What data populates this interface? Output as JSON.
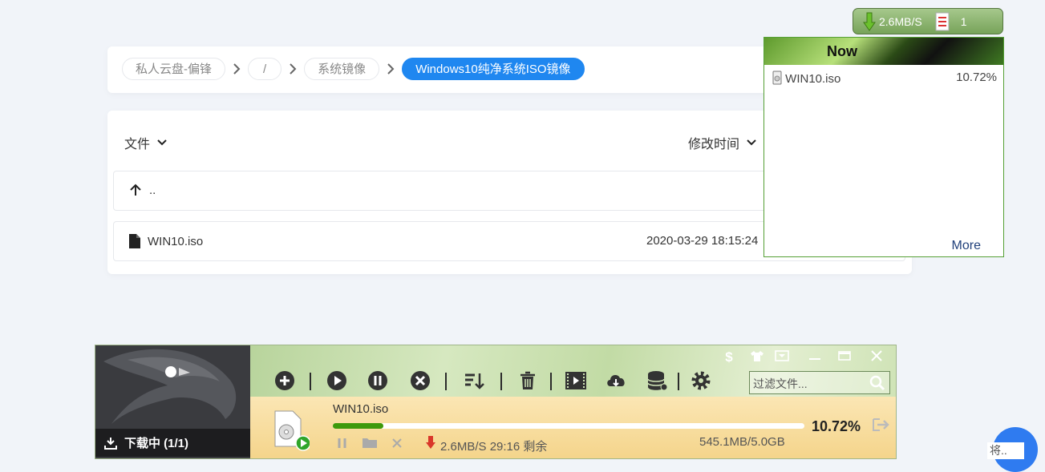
{
  "breadcrumb": {
    "items": [
      "私人云盘-偏锋",
      "/",
      "系统镜像",
      "Windows10纯净系统ISO镜像"
    ]
  },
  "file_list": {
    "col_file": "文件",
    "col_modified": "修改时间",
    "parent_label": "..",
    "rows": [
      {
        "name": "WIN10.iso",
        "modified": "2020-03-29 18:15:24"
      }
    ]
  },
  "speed_badge": {
    "speed": "2.6MB/S",
    "count": "1"
  },
  "popup": {
    "title": "Now",
    "item_name": "WIN10.iso",
    "item_percent": "10.72%",
    "more": "More"
  },
  "downloader": {
    "tab_label": "下载中 (1/1)",
    "filter_placeholder": "过滤文件...",
    "task": {
      "name": "WIN10.iso",
      "percent": "10.72%",
      "progress": 0.1072,
      "speed_eta": "2.6MB/S 29:16 剩余",
      "size": "545.1MB/5.0GB"
    }
  },
  "corner_text": "将..",
  "colors": {
    "accent": "#1f87f0",
    "progress_green": "#3d9a0c",
    "speed_red": "#d9372a"
  },
  "icons": [
    "chevron-right-icon",
    "chevron-down-icon",
    "arrow-up-icon",
    "file-icon",
    "download-arrow-icon",
    "list-icon",
    "plus-icon",
    "play-icon",
    "pause-icon",
    "stop-icon",
    "sort-icon",
    "trash-icon",
    "video-icon",
    "cloud-download-icon",
    "database-icon",
    "gear-icon",
    "search-icon",
    "dollar-icon",
    "shirt-icon",
    "dropdown-icon",
    "minimize-icon",
    "maximize-icon",
    "close-icon",
    "disc-file-icon",
    "folder-icon",
    "export-icon",
    "eagle-logo"
  ]
}
